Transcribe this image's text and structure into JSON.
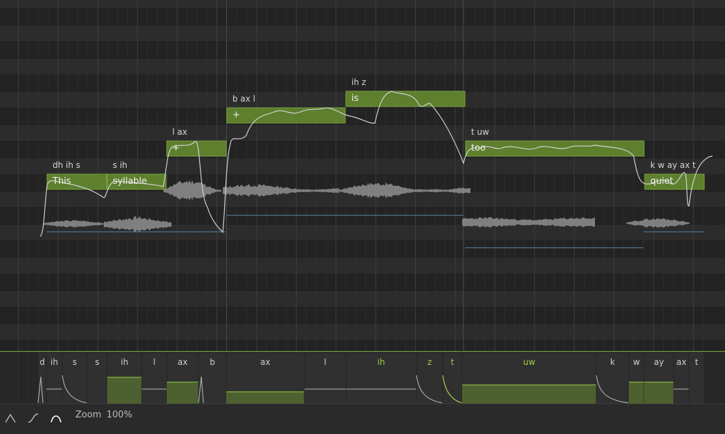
{
  "colors": {
    "note_fill": "#5e7f2e",
    "note_border": "#7aa33c",
    "accent_green": "#a3cf4a",
    "pitch_curve": "#d2d2d2",
    "waveform": "#8f8f8f",
    "row_light": "#2c2c2c",
    "row_dark": "#232323"
  },
  "notes": [
    {
      "lyric": "This",
      "phonemes": "dh ih s"
    },
    {
      "lyric": "syllable",
      "phonemes": "s ih"
    },
    {
      "lyric": "+",
      "phonemes": "l ax"
    },
    {
      "lyric": "+",
      "phonemes": "b ax l"
    },
    {
      "lyric": "is",
      "phonemes": "ih z"
    },
    {
      "lyric": "too",
      "phonemes": "t uw"
    },
    {
      "lyric": "quiet",
      "phonemes": "k w ay ax t"
    }
  ],
  "phoneme_track": [
    {
      "label": "d",
      "highlight": false
    },
    {
      "label": "ih",
      "highlight": false
    },
    {
      "label": "s",
      "highlight": false
    },
    {
      "label": "s",
      "highlight": false
    },
    {
      "label": "ih",
      "highlight": false
    },
    {
      "label": "l",
      "highlight": false
    },
    {
      "label": "ax",
      "highlight": false
    },
    {
      "label": "b",
      "highlight": false
    },
    {
      "label": "ax",
      "highlight": false
    },
    {
      "label": "l",
      "highlight": false
    },
    {
      "label": "ih",
      "highlight": true
    },
    {
      "label": "z",
      "highlight": true
    },
    {
      "label": "t",
      "highlight": true
    },
    {
      "label": "uw",
      "highlight": true
    },
    {
      "label": "k",
      "highlight": false
    },
    {
      "label": "w",
      "highlight": false
    },
    {
      "label": "ay",
      "highlight": false
    },
    {
      "label": "ax",
      "highlight": false
    },
    {
      "label": "t",
      "highlight": false
    }
  ],
  "toolbar": {
    "tools": [
      {
        "icon": "peak-curve-icon"
      },
      {
        "icon": "s-curve-icon"
      },
      {
        "icon": "arch-curve-icon",
        "active": true
      }
    ],
    "zoom_label": "Zoom",
    "zoom_value": "100%"
  }
}
